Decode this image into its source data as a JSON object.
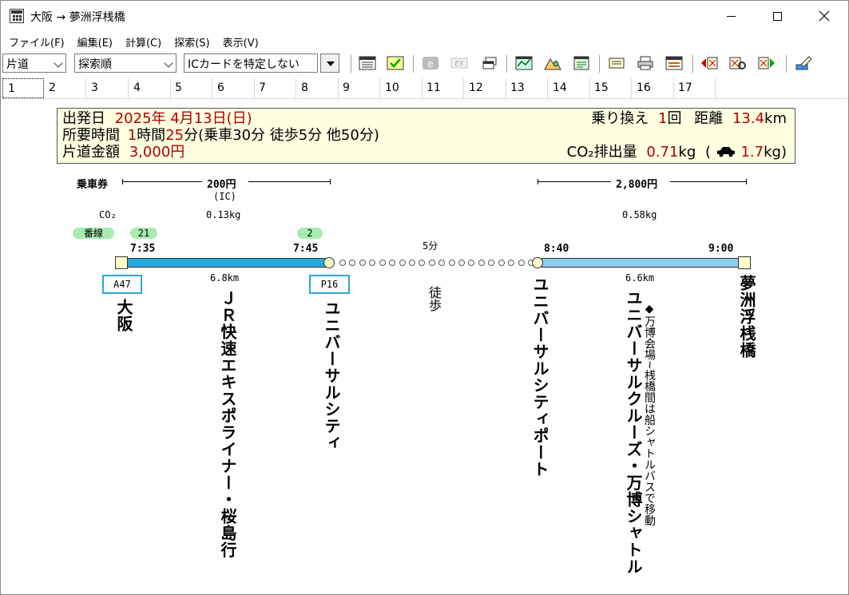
{
  "window": {
    "title": "大阪 → 夢洲浮桟橋"
  },
  "menu": [
    "ファイル(F)",
    "編集(E)",
    "計算(C)",
    "探索(S)",
    "表示(V)"
  ],
  "toolbar": {
    "direction_select": "片道",
    "sort_select": "探索順",
    "ic_select": "ICカードを特定しない"
  },
  "tabs": [
    "1",
    "2",
    "3",
    "4",
    "5",
    "6",
    "7",
    "8",
    "9",
    "10",
    "11",
    "12",
    "13",
    "14",
    "15",
    "16",
    "17"
  ],
  "summary": {
    "departure_label": "出発日",
    "departure_value": "2025年 4月13日(日)",
    "duration_label": "所要時間",
    "duration_hours": "1",
    "duration_hours_unit": "時間",
    "duration_minutes": "25",
    "duration_detail": "分(乗車30分 徒歩5分 他50分)",
    "fare_label": "片道金額",
    "fare_value": "3,000円",
    "transfer_label": "乗り換え",
    "transfer_count": "1",
    "transfer_unit": "回",
    "distance_label": "距離",
    "distance_value": "13.4",
    "distance_unit": "km",
    "co2_label": "CO₂排出量",
    "co2_value": "0.71",
    "co2_unit": "kg",
    "co2_car_open": "(",
    "co2_car_value": "1.7",
    "co2_car_unit": "kg)"
  },
  "route": {
    "ticket_label": "乗車券",
    "co2_label": "CO₂",
    "track_label": "番線",
    "segments": [
      {
        "fare": "200円",
        "fare_note": "(IC)",
        "co2": "0.13kg",
        "dep_track": "21",
        "arr_track": "2",
        "dep_time": "7:35",
        "arr_time": "7:45",
        "distance": "6.8km",
        "dep_platform": "A47",
        "arr_platform": "P16",
        "line_name": "ＪＲ快速エキスポライナー・桜島行",
        "color": "#29a8e0"
      },
      {
        "walk_minutes": "5分",
        "walk_label": "徒歩"
      },
      {
        "fare": "2,800円",
        "co2": "0.58kg",
        "dep_time": "8:40",
        "arr_time": "9:00",
        "distance": "6.6km",
        "line_name": "ユニバーサルクルーズ・万博シャトル",
        "note": "◆万博会場~桟橋間は船シャトルバスで移動",
        "color": "#8ecdf0"
      }
    ],
    "stations": [
      "大阪",
      "ユニバーサルシティ",
      "ユニバーサルシティポート",
      "夢洲浮桟橋"
    ]
  }
}
